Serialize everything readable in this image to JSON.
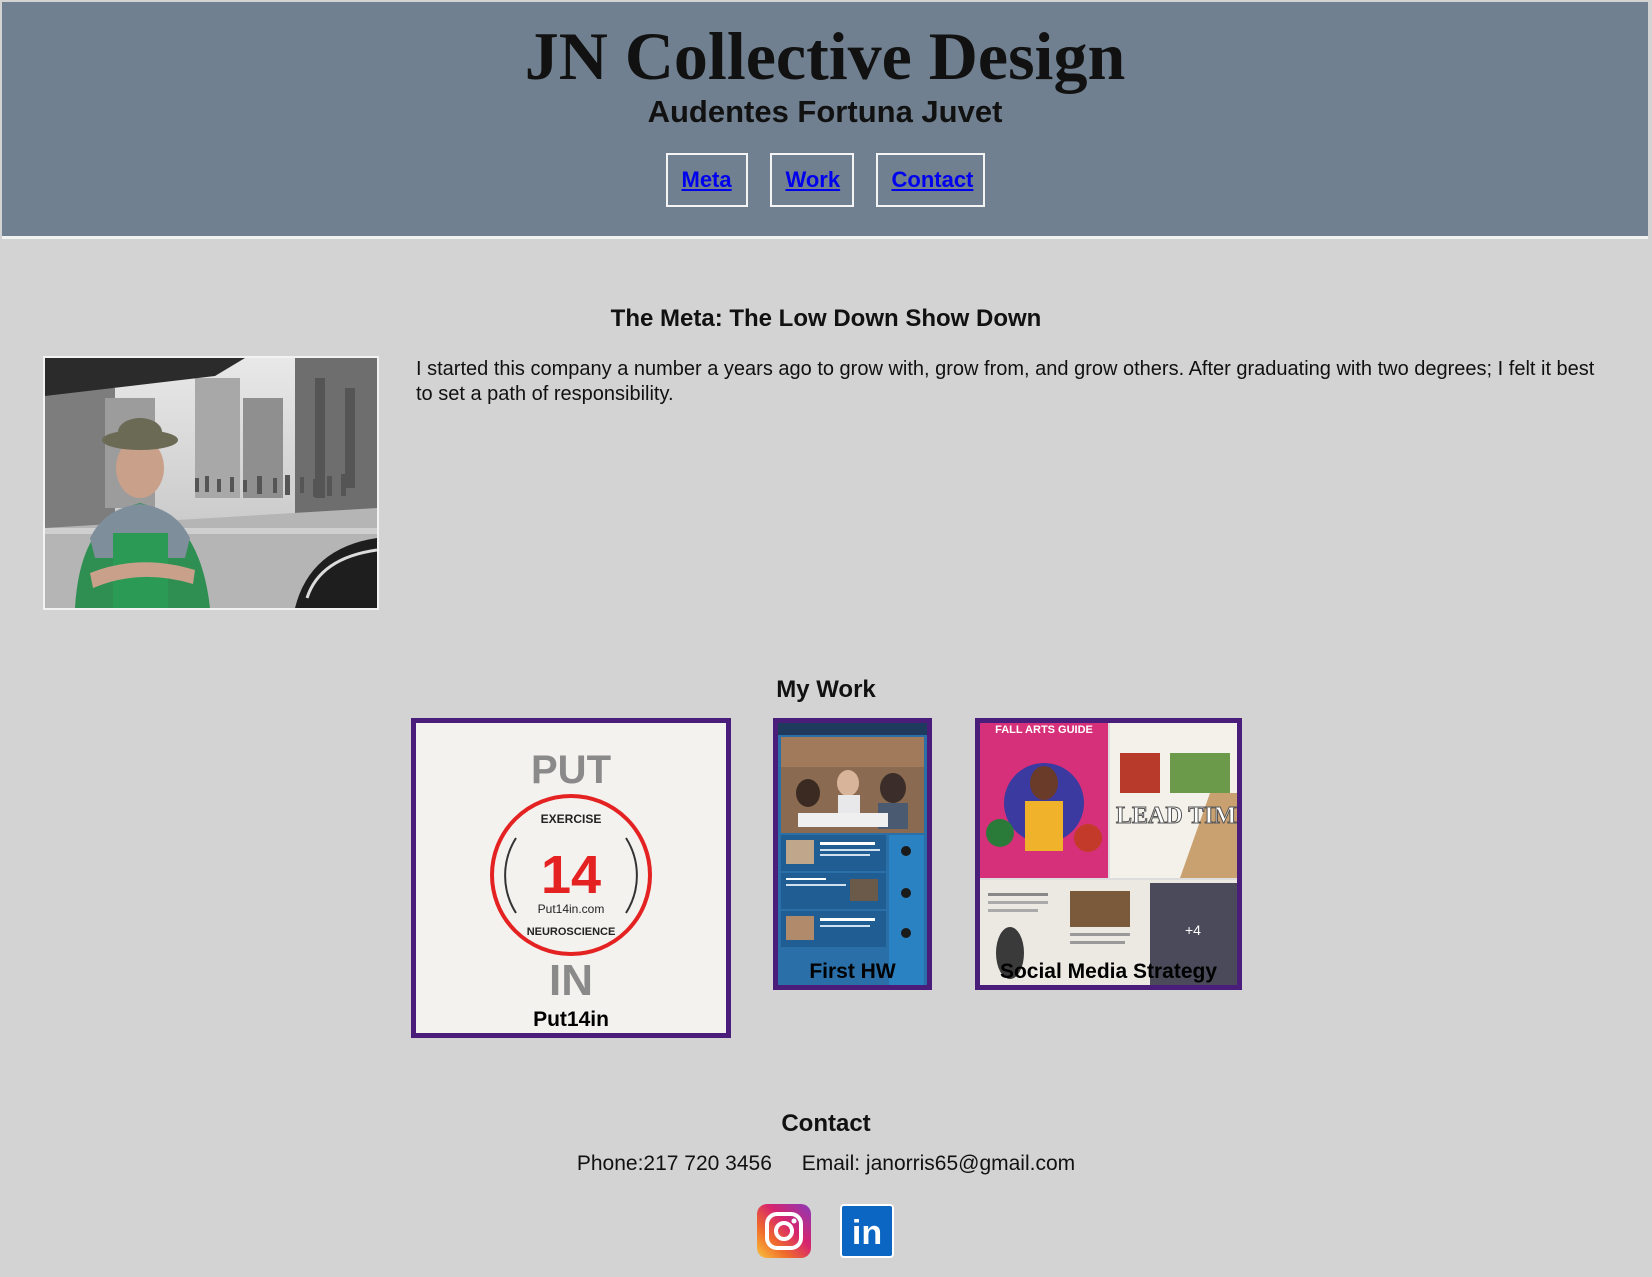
{
  "header": {
    "title": "JN Collective Design",
    "motto": "Audentes Fortuna Juvet",
    "nav": [
      {
        "label": "Meta"
      },
      {
        "label": "Work"
      },
      {
        "label": "Contact"
      }
    ],
    "bg_color": "#708090"
  },
  "meta": {
    "heading": "The Meta: The Low Down Show Down",
    "paragraph": "I started this company a number a years ago to grow with, grow from, and grow others. After graduating with two degrees; I felt it best to set a path of responsibility."
  },
  "work": {
    "heading": "My Work",
    "items": [
      {
        "label": "Put14in",
        "logo_top": "PUT",
        "logo_arc_top": "EXERCISE",
        "logo_number": "14",
        "logo_url": "Put14in.com",
        "logo_arc_bottom": "NEUROSCIENCE",
        "logo_bottom": "IN"
      },
      {
        "label": "First HW"
      },
      {
        "label": "Social Media Strategy",
        "collage_headline": "FALL ARTS GUIDE",
        "collage_lead": "LEAD TIME",
        "collage_more": "+4"
      }
    ],
    "border_color": "#4b1d7a"
  },
  "contact": {
    "heading": "Contact",
    "phone": "Phone:217 720 3456",
    "email": "Email: janorris65@gmail.com",
    "social": [
      {
        "icon": "instagram-icon"
      },
      {
        "icon": "linkedin-icon",
        "text": "in"
      }
    ]
  }
}
